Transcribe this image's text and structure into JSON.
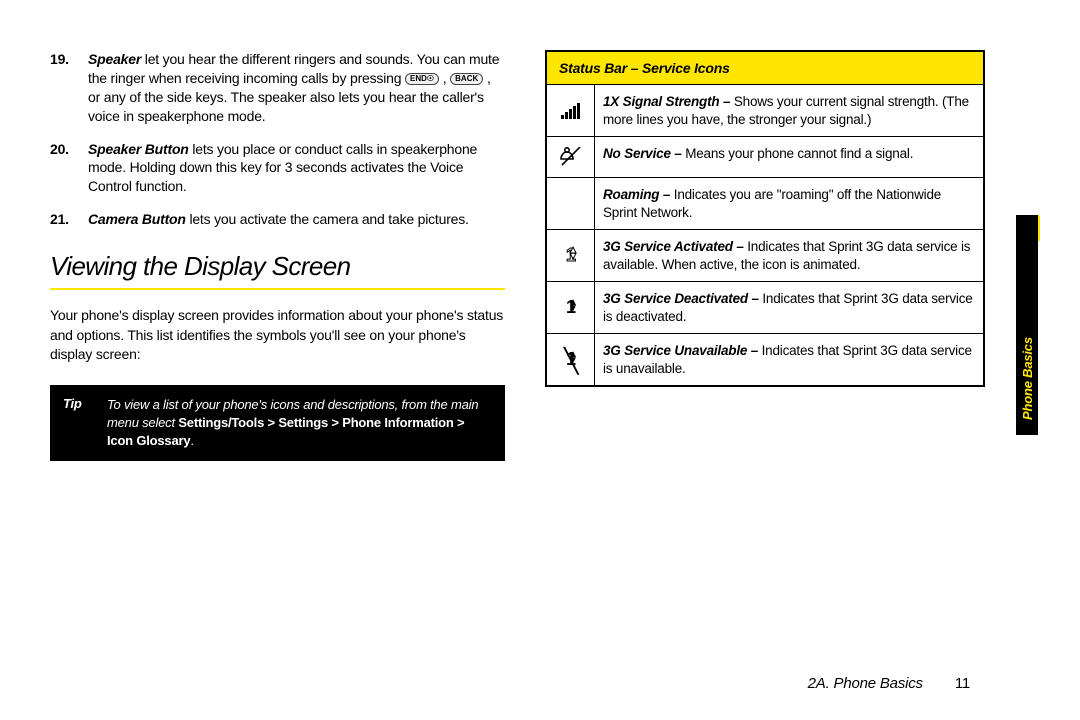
{
  "list": {
    "item19": {
      "num": "19.",
      "term": "Speaker",
      "text_a": " let you hear the different ringers and sounds. You can mute the ringer when receiving incoming calls by pressing ",
      "key1": "END☉",
      "sep": " , ",
      "key2": "BACK",
      "text_b": " , or any of the side keys. The speaker also lets you hear the caller's voice in speakerphone mode."
    },
    "item20": {
      "num": "20.",
      "term": "Speaker Button",
      "text": "  lets you place or conduct calls in speakerphone mode. Holding down this key for 3 seconds activates the Voice Control function."
    },
    "item21": {
      "num": "21.",
      "term": "Camera Button",
      "text": "  lets you activate the camera and take pictures."
    }
  },
  "heading": "Viewing the Display Screen",
  "intro": "Your phone's display screen provides information about your phone's status and options. This list identifies the symbols you'll see on your phone's display screen:",
  "tip": {
    "label": "Tip",
    "italic_part": "To view a list of your phone's icons and descriptions, from the main menu select ",
    "bold_part": "Settings/Tools > Settings > Phone Information > Icon Glossary",
    "tail": "."
  },
  "table": {
    "header": "Status Bar – Service Icons",
    "rows": [
      {
        "icon": "signal-bars-icon",
        "term": "1X Signal Strength – ",
        "text": "Shows your current signal strength. (The more lines you have, the stronger your signal.)"
      },
      {
        "icon": "no-service-icon",
        "term": "No Service – ",
        "text": "Means your phone cannot find a signal."
      },
      {
        "icon": "roaming-icon",
        "term": "Roaming – ",
        "text": "Indicates you are \"roaming\" off the Nationwide Sprint Network."
      },
      {
        "icon": "three-g-active-icon",
        "term": "3G Service Activated – ",
        "text": "Indicates that Sprint 3G data service is available. When active, the icon is animated."
      },
      {
        "icon": "three-g-deactivated-icon",
        "term": "3G Service Deactivated – ",
        "text": "Indicates that Sprint 3G data service is deactivated."
      },
      {
        "icon": "three-g-unavailable-icon",
        "term": "3G Service Unavailable – ",
        "text": "Indicates that Sprint 3G data service is unavailable."
      }
    ]
  },
  "side_tab": "Phone Basics",
  "footer": {
    "section": "2A. Phone Basics",
    "page": "11"
  }
}
